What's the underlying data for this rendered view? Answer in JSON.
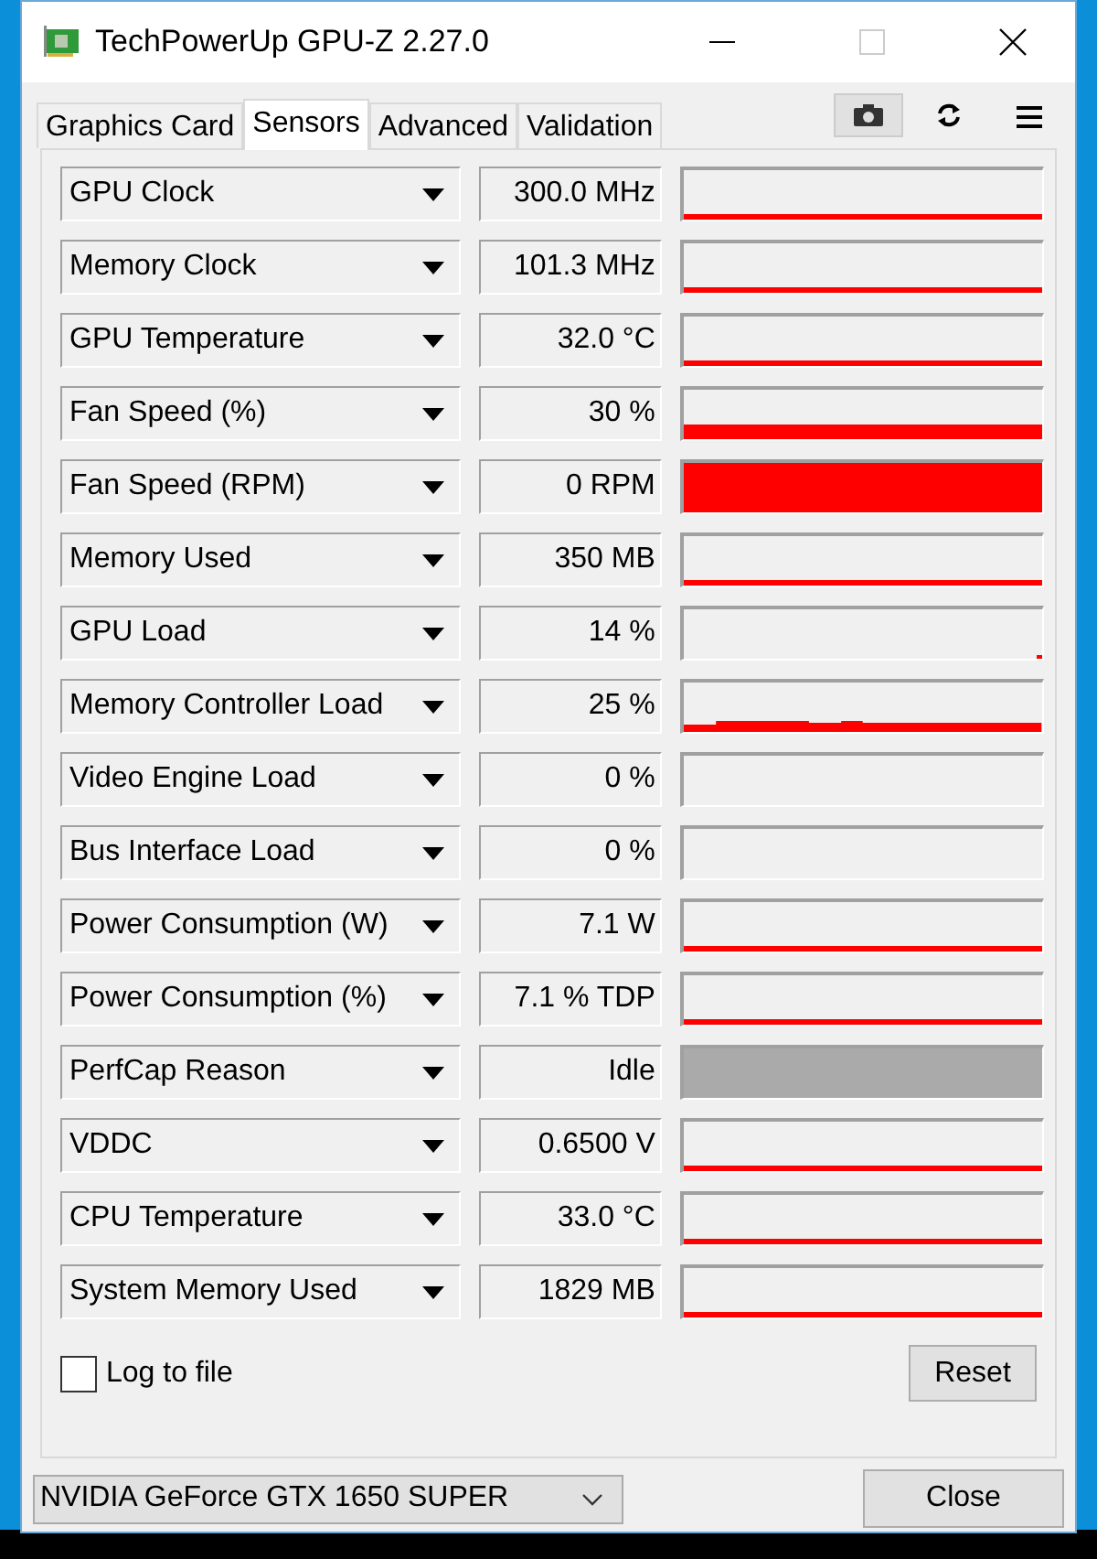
{
  "window": {
    "title": "TechPowerUp GPU-Z 2.27.0"
  },
  "tabs": [
    {
      "label": "Graphics Card",
      "selected": false
    },
    {
      "label": "Sensors",
      "selected": true
    },
    {
      "label": "Advanced",
      "selected": false
    },
    {
      "label": "Validation",
      "selected": false
    }
  ],
  "sensors": [
    {
      "name": "GPU Clock",
      "value": "300.0 MHz",
      "kind": "line"
    },
    {
      "name": "Memory Clock",
      "value": "101.3 MHz",
      "kind": "line"
    },
    {
      "name": "GPU Temperature",
      "value": "32.0 °C",
      "kind": "line"
    },
    {
      "name": "Fan Speed (%)",
      "value": "30 %",
      "kind": "band"
    },
    {
      "name": "Fan Speed (RPM)",
      "value": "0 RPM",
      "kind": "full"
    },
    {
      "name": "Memory Used",
      "value": "350 MB",
      "kind": "line"
    },
    {
      "name": "GPU Load",
      "value": "14 %",
      "kind": "blip"
    },
    {
      "name": "Memory Controller Load",
      "value": "25 %",
      "kind": "noisy"
    },
    {
      "name": "Video Engine Load",
      "value": "0 %",
      "kind": "empty"
    },
    {
      "name": "Bus Interface Load",
      "value": "0 %",
      "kind": "empty"
    },
    {
      "name": "Power Consumption (W)",
      "value": "7.1 W",
      "kind": "line"
    },
    {
      "name": "Power Consumption (%)",
      "value": "7.1 % TDP",
      "kind": "line"
    },
    {
      "name": "PerfCap Reason",
      "value": "Idle",
      "kind": "status"
    },
    {
      "name": "VDDC",
      "value": "0.6500 V",
      "kind": "line"
    },
    {
      "name": "CPU Temperature",
      "value": "33.0 °C",
      "kind": "line"
    },
    {
      "name": "System Memory Used",
      "value": "1829 MB",
      "kind": "line"
    }
  ],
  "log_to_file": {
    "label": "Log to file",
    "checked": false
  },
  "reset_button": "Reset",
  "gpu_select": {
    "value": "NVIDIA GeForce GTX 1650 SUPER"
  },
  "close_button": "Close"
}
